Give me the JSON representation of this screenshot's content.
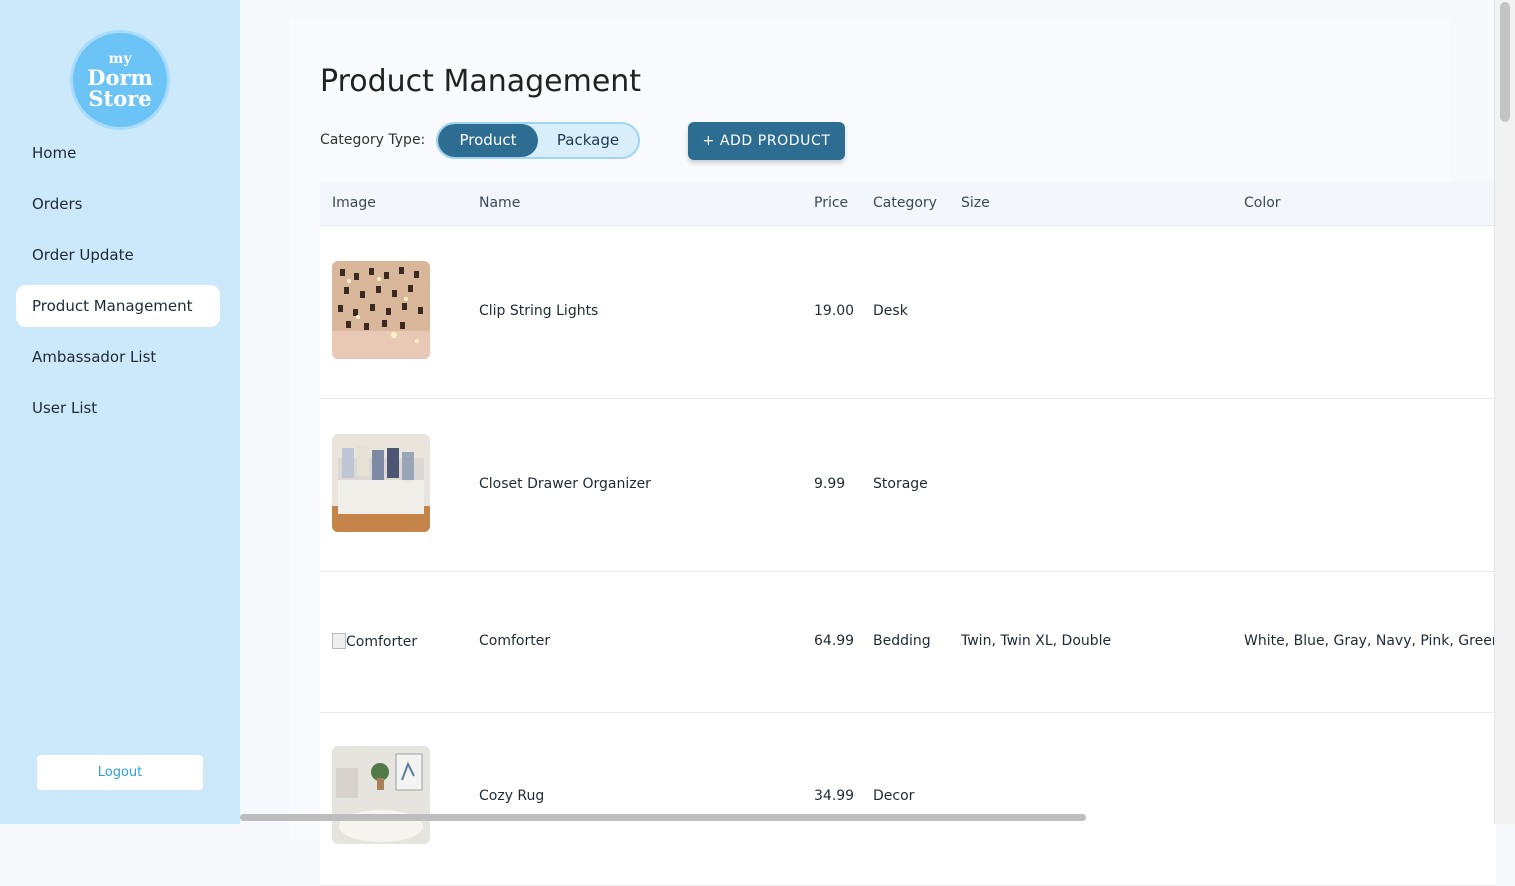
{
  "logo": {
    "line1": "my",
    "line2": "Dorm",
    "line3": "Store"
  },
  "sidebar": {
    "items": [
      {
        "label": "Home"
      },
      {
        "label": "Orders"
      },
      {
        "label": "Order Update"
      },
      {
        "label": "Product Management",
        "active": true
      },
      {
        "label": "Ambassador List"
      },
      {
        "label": "User List"
      }
    ],
    "logout_label": "Logout"
  },
  "main": {
    "title": "Product Management",
    "category_label": "Category Type:",
    "toggle": {
      "selected": "Product",
      "options": [
        "Product",
        "Package"
      ]
    },
    "add_button_label": "+ ADD PRODUCT"
  },
  "table": {
    "headers": [
      "Image",
      "Name",
      "Price",
      "Category",
      "Size",
      "Color"
    ],
    "rows": [
      {
        "name": "Clip String Lights",
        "price": "19.00",
        "category": "Desk",
        "size": "",
        "color": "",
        "image_alt": ""
      },
      {
        "name": "Closet Drawer Organizer",
        "price": "9.99",
        "category": "Storage",
        "size": "",
        "color": "",
        "image_alt": ""
      },
      {
        "name": "Comforter",
        "price": "64.99",
        "category": "Bedding",
        "size": "Twin, Twin XL, Double",
        "color": "White, Blue, Gray, Navy, Pink, Green",
        "image_alt": "Comforter"
      },
      {
        "name": "Cozy Rug",
        "price": "34.99",
        "category": "Decor",
        "size": "",
        "color": "",
        "image_alt": ""
      }
    ]
  },
  "colors": {
    "sidebar_bg": "#cce9fb",
    "accent": "#2e6d92",
    "logo": "#6cc3f5",
    "logout_text": "#2c9fd8"
  }
}
